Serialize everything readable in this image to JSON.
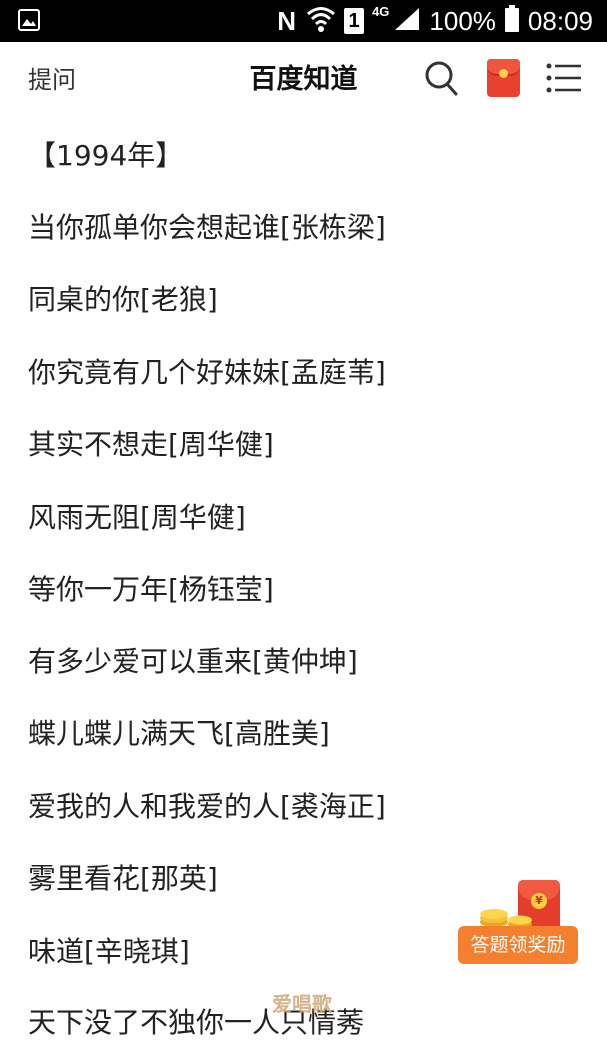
{
  "status_bar": {
    "network_letter": "N",
    "sim_slot": "1",
    "network_type": "4G",
    "battery": "100%",
    "time": "08:09"
  },
  "header": {
    "ask_label": "提问",
    "title": "百度知道"
  },
  "songs": [
    "【1994年】",
    "当你孤单你会想起谁[张栋梁]",
    "同桌的你[老狼]",
    "你究竟有几个好妹妹[孟庭苇]",
    "其实不想走[周华健]",
    "风雨无阻[周华健]",
    "等你一万年[杨钰莹]",
    "有多少爱可以重来[黄仲坤]",
    "蝶儿蝶儿满天飞[高胜美]",
    "爱我的人和我爱的人[裘海正]",
    "雾里看花[那英]",
    "味道[辛晓琪]",
    "天下没了不独你一人只情莠"
  ],
  "reward_button": {
    "label": "答题领奖励"
  },
  "watermark": "爱唱歌",
  "colors": {
    "statusbar": "#000000",
    "reward_orange": "#f47f2f",
    "redpacket_red": "#e8412f"
  }
}
